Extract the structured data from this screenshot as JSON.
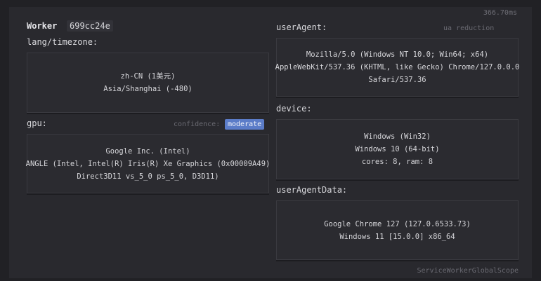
{
  "timing": "366.70ms",
  "worker": {
    "title": "Worker",
    "id": "699cc24e"
  },
  "lang": {
    "label": "lang/timezone:",
    "lines": [
      "zh-CN (1美元)",
      "Asia/Shanghai (-480)"
    ]
  },
  "gpu": {
    "label": "gpu:",
    "confidence_label": "confidence:",
    "confidence_value": "moderate",
    "lines": [
      "Google Inc. (Intel)",
      "ANGLE (Intel, Intel(R) Iris(R) Xe Graphics (0x00009A49)",
      "Direct3D11 vs_5_0 ps_5_0, D3D11)"
    ]
  },
  "userAgent": {
    "label": "userAgent:",
    "note": "ua reduction",
    "lines": [
      "Mozilla/5.0 (Windows NT 10.0; Win64; x64)",
      "AppleWebKit/537.36 (KHTML, like Gecko) Chrome/127.0.0.0",
      "Safari/537.36"
    ]
  },
  "device": {
    "label": "device:",
    "lines": [
      "Windows (Win32)",
      "Windows 10 (64-bit)",
      "cores: 8, ram: 8"
    ]
  },
  "userAgentData": {
    "label": "userAgentData:",
    "lines": [
      "Google Chrome 127 (127.0.6533.73)",
      "Windows 11 [15.0.0] x86_64"
    ]
  },
  "scope": "ServiceWorkerGlobalScope",
  "colors": {
    "badge": "#5b7cc8",
    "background": "#212125",
    "panel": "#29292e"
  }
}
